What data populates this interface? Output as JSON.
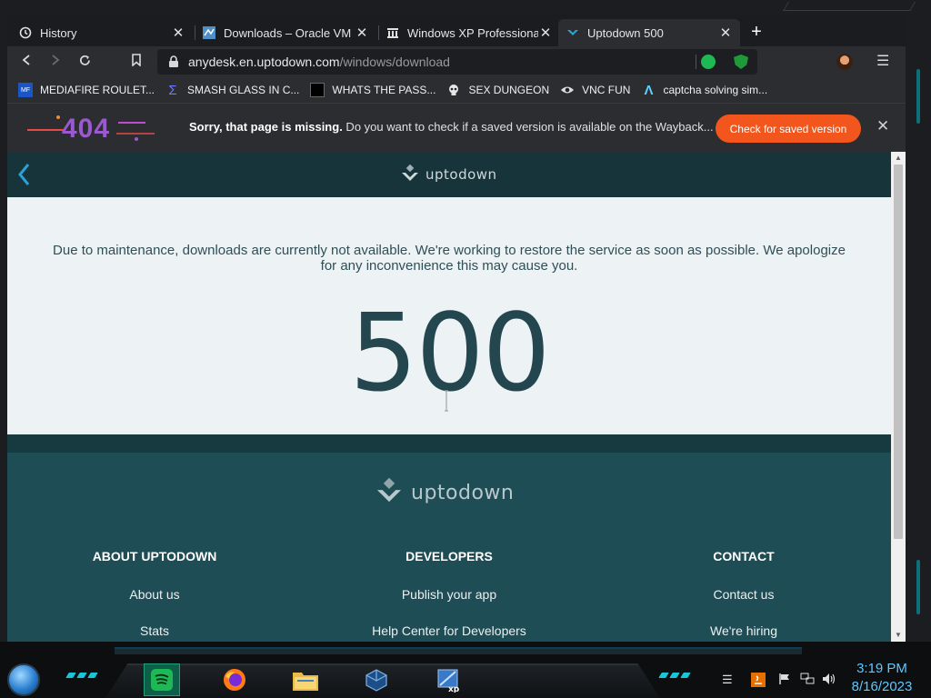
{
  "tabs": [
    {
      "title": "History",
      "icon": "history-icon",
      "active": false
    },
    {
      "title": "Downloads – Oracle VM Vi",
      "icon": "virtualbox-site-icon",
      "active": false
    },
    {
      "title": "Windows XP Professional S",
      "icon": "archive-org-icon",
      "active": false
    },
    {
      "title": "Uptodown 500",
      "icon": "uptodown-icon",
      "active": true
    }
  ],
  "address": {
    "host": "anydesk.en.uptodown.com",
    "path": "/windows/download"
  },
  "bookmarks": [
    {
      "label": "MEDIAFIRE ROULET...",
      "icon": "mediafire-icon",
      "icon_text": "MF"
    },
    {
      "label": "SMASH GLASS IN C...",
      "icon": "sigma-icon",
      "icon_text": "Σ"
    },
    {
      "label": "WHATS THE PASS...",
      "icon": "dark-square-icon",
      "icon_text": ""
    },
    {
      "label": "SEX DUNGEON",
      "icon": "roblox-skull-icon",
      "icon_text": ""
    },
    {
      "label": "VNC FUN",
      "icon": "vnc-eye-icon",
      "icon_text": ""
    },
    {
      "label": "captcha solving sim...",
      "icon": "lambda-icon",
      "icon_text": "Λ"
    }
  ],
  "infobar": {
    "logo_text": "404",
    "bold": "Sorry, that page is missing.",
    "text": " Do you want to check if a saved version is available on the Wayback...",
    "button": "Check for saved version"
  },
  "site": {
    "brand": "uptodown",
    "message": "Due to maintenance, downloads are currently not available. We're working to restore the service as soon as possible. We apologize for any inconvenience this may cause you.",
    "error_code": "500"
  },
  "footer": {
    "brand": "uptodown",
    "columns": [
      {
        "heading": "ABOUT UPTODOWN",
        "links": [
          "About us",
          "Stats"
        ]
      },
      {
        "heading": "DEVELOPERS",
        "links": [
          "Publish your app",
          "Help Center for Developers"
        ]
      },
      {
        "heading": "CONTACT",
        "links": [
          "Contact us",
          "We're hiring"
        ]
      }
    ]
  },
  "taskbar": {
    "apps": [
      "spotify-icon",
      "firefox-icon",
      "file-explorer-icon",
      "virtualbox-icon",
      "windows-xp-icon"
    ],
    "tray_icons": [
      "java-icon",
      "flag-icon",
      "network-icon",
      "volume-icon"
    ],
    "time": "3:19 PM",
    "date": "8/16/2023"
  },
  "colors": {
    "site_header": "#16343a",
    "footer": "#1f4d55",
    "error_code": "#23464f",
    "accent_button": "#f2561d"
  }
}
